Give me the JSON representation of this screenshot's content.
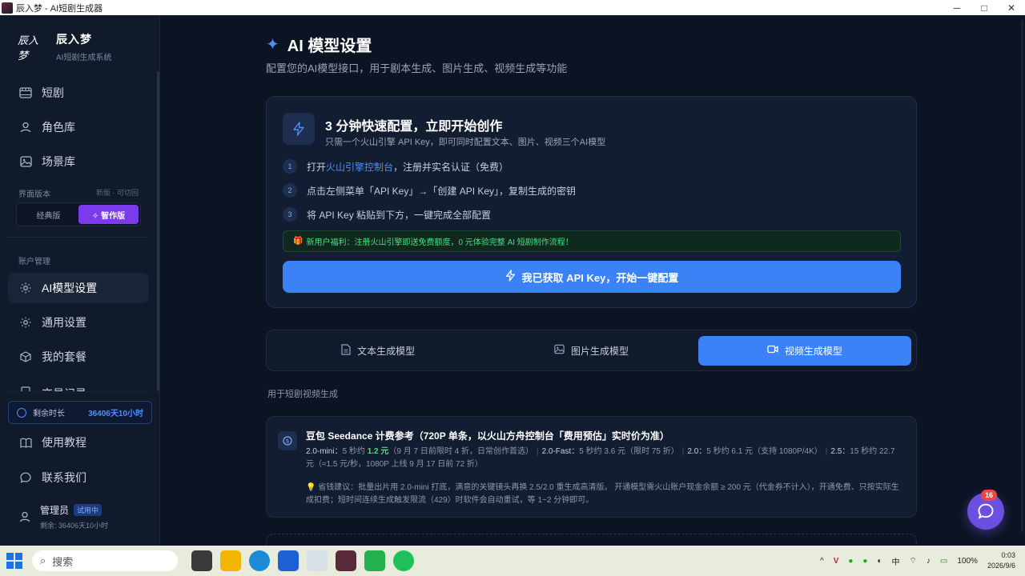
{
  "window": {
    "title": "辰入梦 - AI短剧生成器",
    "controls": [
      "─",
      "□",
      "✕"
    ]
  },
  "sidebar": {
    "logo_mark": "辰入梦",
    "logo_name": "辰入梦",
    "logo_sub": "AI短剧生成系统",
    "nav_top": [
      {
        "label": "短剧",
        "icon": "film-icon"
      },
      {
        "label": "角色库",
        "icon": "user-icon"
      },
      {
        "label": "场景库",
        "icon": "image-icon"
      }
    ],
    "ui_version_label": "界面版本",
    "ui_version_hint": "新版 · 可切回",
    "version_options": [
      "经典版",
      "✧ 智作版"
    ],
    "account_label": "账户管理",
    "nav_account": [
      {
        "label": "AI模型设置",
        "icon": "sun-icon",
        "active": true
      },
      {
        "label": "通用设置",
        "icon": "gear-icon"
      },
      {
        "label": "我的套餐",
        "icon": "box-icon"
      },
      {
        "label": "交易记录",
        "icon": "receipt-icon"
      }
    ],
    "remaining_label": "剩余时长",
    "remaining_value": "36406天10小时",
    "nav_bottom": [
      {
        "label": "使用教程",
        "icon": "book-icon"
      },
      {
        "label": "联系我们",
        "icon": "message-icon"
      }
    ],
    "user": {
      "name": "管理员",
      "badge": "试用中",
      "remaining": "剩余: 36406天10小时"
    }
  },
  "main": {
    "title_icon": "✦",
    "title": "AI 模型设置",
    "subtitle": "配置您的AI模型接口，用于剧本生成、图片生成、视频生成等功能",
    "quick": {
      "title": "3 分钟快速配置，立即开始创作",
      "subtitle": "只需一个火山引擎 API Key，即可同时配置文本、图片、视频三个AI模型",
      "steps": [
        {
          "num": "1",
          "pre": "打开 ",
          "link": "火山引擎控制台",
          "post": "，注册并实名认证（免费）"
        },
        {
          "num": "2",
          "pre": "点击左侧菜单「API Key」→「创建 API Key」，复制生成的密钥",
          "link": "",
          "post": ""
        },
        {
          "num": "3",
          "pre": "将 API Key 粘贴到下方，一键完成全部配置",
          "link": "",
          "post": ""
        }
      ],
      "benefit": "新用户福利：注册火山引擎即送免费额度，0 元体验完整 AI 短剧制作流程！",
      "cta": "我已获取 API Key，开始一键配置"
    },
    "tabs": [
      {
        "label": "文本生成模型",
        "icon": "document-icon",
        "active": false
      },
      {
        "label": "图片生成模型",
        "icon": "image-icon",
        "active": false
      },
      {
        "label": "视频生成模型",
        "icon": "video-icon",
        "active": true
      }
    ],
    "for_text": "用于短剧视频生成",
    "price": {
      "title": "豆包 Seedance 计费参考（720P 单条，以火山方舟控制台「费用预估」实时价为准）",
      "items": [
        {
          "name": "2.0-mini：",
          "text": "5 秒约 ",
          "highlight": "1.2 元",
          "note": "（9 月 7 日前限时 4 折，日常创作首选）"
        },
        {
          "name": "2.0-Fast：",
          "text": "5 秒约 3.6 元（限时 75 折）",
          "highlight": "",
          "note": ""
        },
        {
          "name": "2.0：",
          "text": "5 秒约 6.1 元（支持 1080P/4K）",
          "highlight": "",
          "note": ""
        },
        {
          "name": "2.5：",
          "text": "15 秒约 22.7 元（≈1.5 元/秒，1080P 上线 9 月 17 日前 72 折）",
          "highlight": "",
          "note": ""
        }
      ],
      "tip": "省钱建议：批量出片用 2.0-mini 打底，满意的关键镜头再换 2.5/2.0 重生成高清版。 开通模型需火山账户现金余额 ≥ 200 元（代金券不计入），开通免费、只按实际生成扣费；短时间连续生成触发限流（429）时软件会自动重试，等 1~2 分钟即可。"
    },
    "chat_badge": "16"
  },
  "taskbar": {
    "search_placeholder": "搜索",
    "time": "0:03",
    "date": "2026/9/6",
    "battery": "100%",
    "ime": "中"
  },
  "colors": {
    "accent": "#3b82f6",
    "sidebar_bg": "#111a2b",
    "main_bg": "#0c1322",
    "success": "#4ade80",
    "purple": "#7c3aed"
  }
}
